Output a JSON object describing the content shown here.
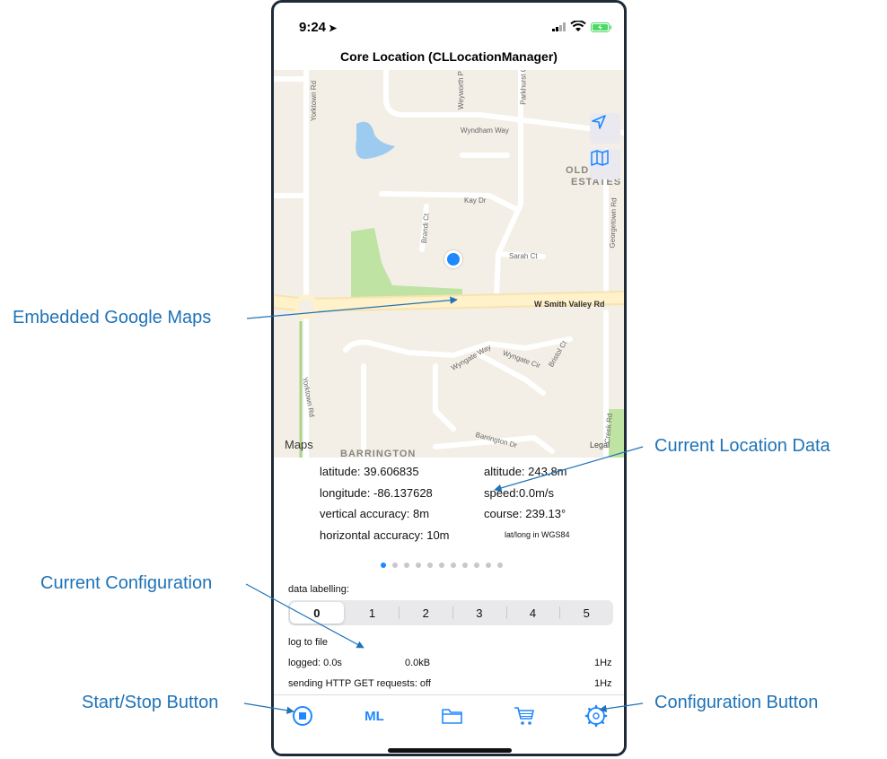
{
  "status_bar": {
    "time": "9:24"
  },
  "nav": {
    "title": "Core Location (CLLocationManager)"
  },
  "map": {
    "labels": {
      "yorktown_top": "Yorktown Rd",
      "weyworth": "Weyworth P",
      "parkhurst": "Parkhurst Ct",
      "wyndham": "Wyndham Way",
      "old_estates_1": "OLDE",
      "old_estates_2": "ESTATES",
      "kay": "Kay Dr",
      "brandi": "Brandi Ct",
      "georgetown": "Georgetown Rd",
      "sarah": "Sarah Ct",
      "smith_valley": "W Smith Valley Rd",
      "wyngate_way": "Wyngate Way",
      "wyngate_cir": "Wyngate Cir",
      "bristol": "Bristol Ct",
      "yorktown_bottom": "Yorktown Rd",
      "barrington_dr": "Barrington Dr",
      "barrington": "BARRINGTON",
      "creek": "Creek Rd"
    },
    "attribution": "Maps",
    "legal": "Legal"
  },
  "location": {
    "latitude": "latitude: 39.606835",
    "longitude": "longitude: -86.137628",
    "vertical_accuracy": "vertical accuracy: 8m",
    "horizontal_accuracy": "horizontal accuracy: 10m",
    "altitude": "altitude: 243.8m",
    "speed": "speed:0.0m/s",
    "course": "course: 239.13°",
    "datum": "lat/long in WGS84"
  },
  "pager": {
    "count": 11,
    "active": 0
  },
  "config": {
    "data_labelling_label": "data labelling:",
    "segments": [
      "0",
      "1",
      "2",
      "3",
      "4",
      "5"
    ],
    "selected_segment": "0",
    "log_to_file": "log to file",
    "logged": "logged:  0.0s",
    "logged_size": "0.0kB",
    "logged_rate": "1Hz",
    "http": "sending HTTP GET requests: off",
    "http_rate": "1Hz"
  },
  "tabbar": {
    "ml_label": "ML"
  },
  "callouts": {
    "embedded_maps": "Embedded Google Maps",
    "current_location": "Current Location Data",
    "current_config": "Current Configuration",
    "start_stop": "Start/Stop Button",
    "config_button": "Configuration Button"
  },
  "colors": {
    "accent": "#1e88ff",
    "callout": "#1f73b7"
  }
}
